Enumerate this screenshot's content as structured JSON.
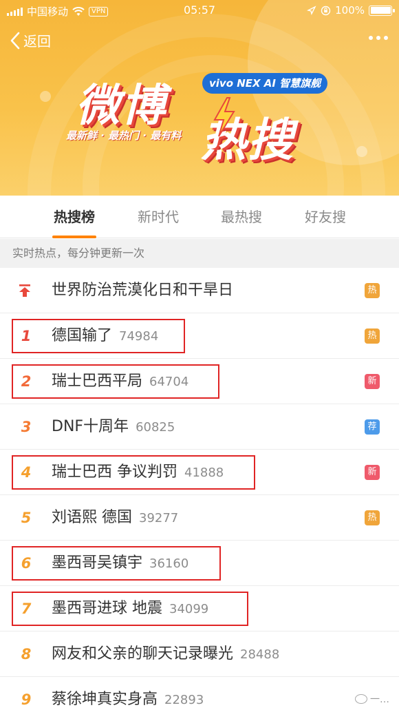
{
  "status_bar": {
    "carrier": "中国移动",
    "vpn": "VPN",
    "time": "05:57",
    "battery": "100%",
    "battery_level": 1.0
  },
  "nav": {
    "back_label": "返回"
  },
  "banner": {
    "title_part1": "微博",
    "title_part2": "热搜",
    "brand": "vivo NEX AI 智慧旗舰",
    "tagline": "最新鲜 · 最热门 · 最有料"
  },
  "tabs": [
    {
      "label": "热搜榜",
      "active": true
    },
    {
      "label": "新时代",
      "active": false
    },
    {
      "label": "最热搜",
      "active": false
    },
    {
      "label": "好友搜",
      "active": false
    }
  ],
  "notice": "实时热点，每分钟更新一次",
  "hot_list": [
    {
      "rank": "",
      "pinned": true,
      "title": "世界防治荒漠化日和干旱日",
      "count": "",
      "badge": "热",
      "badge_color": "#f0a53a",
      "rank_color": "#e8483c",
      "highlighted": false
    },
    {
      "rank": "1",
      "pinned": false,
      "title": "德国输了",
      "count": "74984",
      "badge": "热",
      "badge_color": "#f0a53a",
      "rank_color": "#e8483c",
      "highlighted": true
    },
    {
      "rank": "2",
      "pinned": false,
      "title": "瑞士巴西平局",
      "count": "64704",
      "badge": "新",
      "badge_color": "#ef5a6b",
      "rank_color": "#f26a3a",
      "highlighted": true
    },
    {
      "rank": "3",
      "pinned": false,
      "title": "DNF十周年",
      "count": "60825",
      "badge": "荐",
      "badge_color": "#4d9bea",
      "rank_color": "#f57c34",
      "highlighted": false
    },
    {
      "rank": "4",
      "pinned": false,
      "title": "瑞士巴西 争议判罚",
      "count": "41888",
      "badge": "新",
      "badge_color": "#ef5a6b",
      "rank_color": "#f5a02e",
      "highlighted": true
    },
    {
      "rank": "5",
      "pinned": false,
      "title": "刘语熙 德国",
      "count": "39277",
      "badge": "热",
      "badge_color": "#f0a53a",
      "rank_color": "#f5a02e",
      "highlighted": false
    },
    {
      "rank": "6",
      "pinned": false,
      "title": "墨西哥吴镇宇",
      "count": "36160",
      "badge": "",
      "badge_color": "",
      "rank_color": "#f5a02e",
      "highlighted": true
    },
    {
      "rank": "7",
      "pinned": false,
      "title": "墨西哥进球 地震",
      "count": "34099",
      "badge": "",
      "badge_color": "",
      "rank_color": "#f5a02e",
      "highlighted": true
    },
    {
      "rank": "8",
      "pinned": false,
      "title": "网友和父亲的聊天记录曝光",
      "count": "28488",
      "badge": "",
      "badge_color": "",
      "rank_color": "#f5a02e",
      "highlighted": false
    },
    {
      "rank": "9",
      "pinned": false,
      "title": "蔡徐坤真实身高",
      "count": "22893",
      "badge": "",
      "badge_color": "",
      "rank_color": "#f5a02e",
      "highlighted": false
    }
  ],
  "watermark": "一…"
}
